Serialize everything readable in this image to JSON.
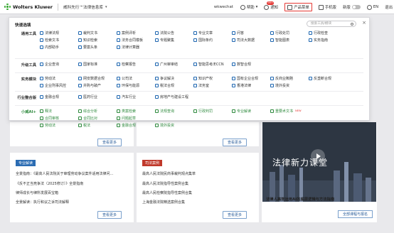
{
  "topbar": {
    "logo": "Wolters Kluwer",
    "brand": "威科先行™法律信息库",
    "user": "wkwechat",
    "help": "帮助",
    "notify": "通知",
    "notify_badge": "99+",
    "product_menu": "产品菜单",
    "mobile": "手机版",
    "new_version": "新版",
    "lang": "EN",
    "logout": "退出",
    "brand_color": "#3aa935",
    "highlight_color": "#e53935"
  },
  "menu": {
    "title": "快速选填",
    "search_placeholder": "搜索工具/模块",
    "sections": [
      {
        "label": "通用工具",
        "rows": [
          [
            "法律法规",
            "裁判文书",
            "案例评析",
            "法院公告",
            "专业文章",
            "问答",
            "行政处罚",
            "行政检查"
          ],
          [
            "检索文书",
            "知识检索",
            "法务合同模板",
            "专题聚集",
            "国际条约",
            "司法大数据",
            "智能图表",
            "实务指南"
          ],
          [
            "内部助手",
            "要案头条",
            "法律计算器"
          ]
        ]
      },
      {
        "label": "升级工具",
        "rows": [
          [
            "企业查询",
            "国家标准",
            "检察报告",
            "广州审审结",
            "智能思考/ECCN",
            "数智合规"
          ]
        ]
      },
      {
        "label": "实务模块",
        "rows": [
          [
            "劳动法",
            "网安数据合规",
            "公司法",
            "争议解决",
            "知识产权",
            "国有企业合规",
            "反商业贿赂",
            "反垄断合规"
          ],
          [
            "企业刑事风控",
            "并购与破产",
            "环保与能源",
            "税法合规",
            "法务室",
            "香港法律",
            "境外投资"
          ]
        ]
      },
      {
        "label": "行业整合版",
        "rows": [
          [
            "金融合规",
            "医药行业",
            "汽车行业",
            "房地产与建设工程"
          ]
        ]
      },
      {
        "label": "小威AI+",
        "ai": true,
        "rows": [
          [
            "释法",
            "综合分析",
            "类案检索",
            "法规查询",
            "行政判罚",
            "专业解读",
            "重要术文书"
          ],
          [
            "合同审核",
            "合同比对",
            "问题起草"
          ],
          [
            "劳动法",
            "税法",
            "金融合规",
            "境外投资"
          ]
        ]
      }
    ],
    "ai_new_tag": "NEW"
  },
  "background": {
    "more_label": "查看更多",
    "left_panel": {
      "tag": "专业解读",
      "lines": [
        "全景指南：《最高人民法院关于审理劳动争议案件适用法律问...",
        "《反不正当竞争法（2025修订）》全景指南",
        "律师成长与律所发展百宝箱",
        "全景解读：执行和议之诉司法解释"
      ]
    },
    "mid_panel": {
      "tag": "司法案例",
      "lines": [
        "最高人民法院民商事裁判观点集萃",
        "最高人民法院指导性案例合集",
        "最高人民检察院指导性案例合集",
        "上海金融法院精选案例合集"
      ]
    },
    "promo": {
      "title": "法律新力课堂",
      "caption": "法律人高效运用AI的底层逻辑与方法指南",
      "button": "全部课程与报名"
    }
  }
}
